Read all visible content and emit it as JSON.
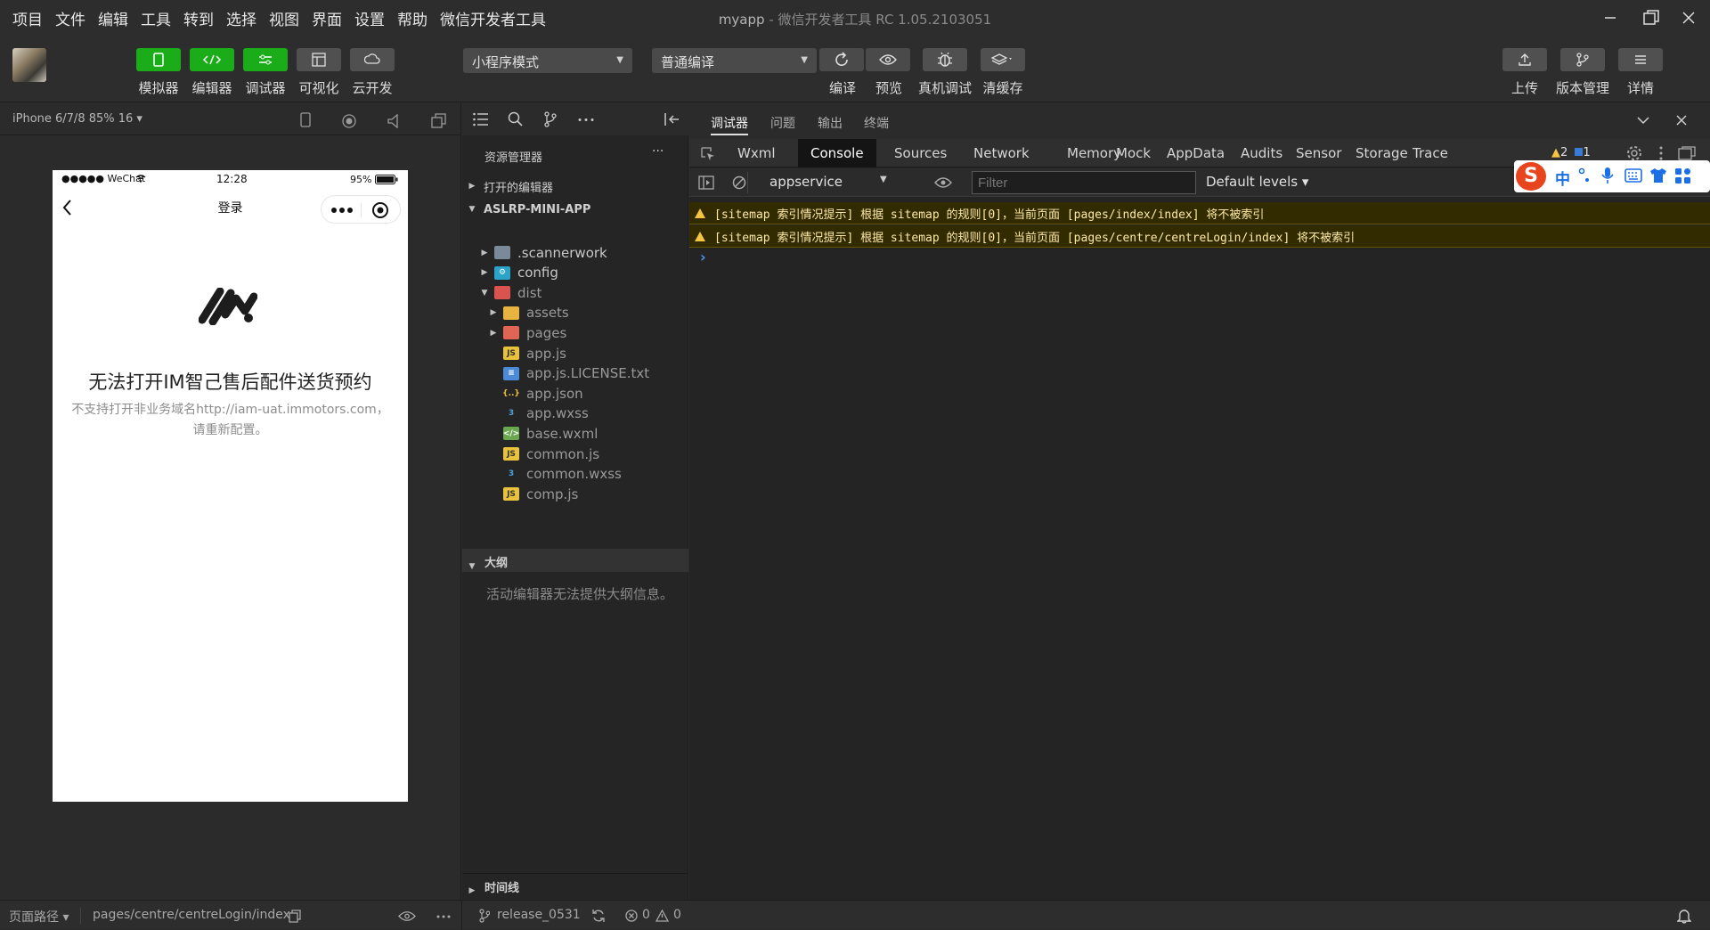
{
  "menubar": [
    "项目",
    "文件",
    "编辑",
    "工具",
    "转到",
    "选择",
    "视图",
    "界面",
    "设置",
    "帮助",
    "微信开发者工具"
  ],
  "window": {
    "app": "myapp",
    "sep": " - ",
    "title": "微信开发者工具 RC 1.05.2103051"
  },
  "toolbar": {
    "modes": [
      {
        "label": "模拟器",
        "icon": "phone-icon"
      },
      {
        "label": "编辑器",
        "icon": "code-icon"
      },
      {
        "label": "调试器",
        "icon": "debug-icon"
      },
      {
        "label": "可视化",
        "icon": "layout-icon"
      },
      {
        "label": "云开发",
        "icon": "cloud-icon"
      }
    ],
    "mode_select": "小程序模式",
    "compile_select": "普通编译",
    "actions": [
      {
        "label": "编译",
        "icon": "refresh-icon"
      },
      {
        "label": "预览",
        "icon": "eye-icon"
      },
      {
        "label": "真机调试",
        "icon": "bug-icon"
      },
      {
        "label": "清缓存",
        "icon": "layers-icon"
      }
    ],
    "right": [
      {
        "label": "上传",
        "icon": "upload-icon"
      },
      {
        "label": "版本管理",
        "icon": "branch-icon"
      },
      {
        "label": "详情",
        "icon": "menu-icon"
      }
    ]
  },
  "simulator": {
    "device": "iPhone 6/7/8 85% 16 ▾",
    "status": {
      "carrier": "●●●●● WeChat",
      "time": "12:28",
      "battery": "95%"
    },
    "nav_title": "登录",
    "error_title": "无法打开IM智己售后配件送货预约",
    "error_desc": "不支持打开非业务域名http://iam-uat.immotors.com，请重新配置。"
  },
  "explorer": {
    "title": "资源管理器",
    "more": "···",
    "open_editors": "打开的编辑器",
    "project": "ASLRP-MINI-APP",
    "tree": [
      {
        "label": ".scannerwork",
        "type": "folder"
      },
      {
        "label": "config",
        "type": "folder-config"
      },
      {
        "label": "dist",
        "type": "folder-dist"
      },
      {
        "label": "assets",
        "type": "folder-yellow"
      },
      {
        "label": "pages",
        "type": "folder-red"
      },
      {
        "label": "app.js",
        "type": "js"
      },
      {
        "label": "app.js.LICENSE.txt",
        "type": "txt"
      },
      {
        "label": "app.json",
        "type": "json"
      },
      {
        "label": "app.wxss",
        "type": "wxss"
      },
      {
        "label": "base.wxml",
        "type": "wxml"
      },
      {
        "label": "common.js",
        "type": "js"
      },
      {
        "label": "common.wxss",
        "type": "wxss"
      },
      {
        "label": "comp.js",
        "type": "js"
      }
    ],
    "outline": "大纲",
    "outline_msg": "活动编辑器无法提供大纲信息。",
    "timeline": "时间线"
  },
  "debug": {
    "top_tabs": [
      "调试器",
      "问题",
      "输出",
      "终端"
    ],
    "tabs": [
      "Wxml",
      "Console",
      "Sources",
      "Network",
      "Memory",
      "Mock",
      "AppData",
      "Audits",
      "Sensor",
      "Storage",
      "Trace"
    ],
    "warn_count": "2",
    "info_count": "1",
    "context": "appservice",
    "filter_placeholder": "Filter",
    "levels": "Default levels ▾",
    "messages": [
      "[sitemap 索引情况提示] 根据 sitemap 的规则[0]，当前页面 [pages/index/index] 将不被索引",
      "[sitemap 索引情况提示] 根据 sitemap 的规则[0]，当前页面 [pages/centre/centreLogin/index] 将不被索引"
    ],
    "prompt": "›"
  },
  "statusbar": {
    "path_label": "页面路径 ▾",
    "path": "pages/centre/centreLogin/index",
    "branch": "release_0531",
    "errors": "0",
    "warnings": "0"
  },
  "ime": {
    "logo": "S",
    "lang": "中"
  }
}
